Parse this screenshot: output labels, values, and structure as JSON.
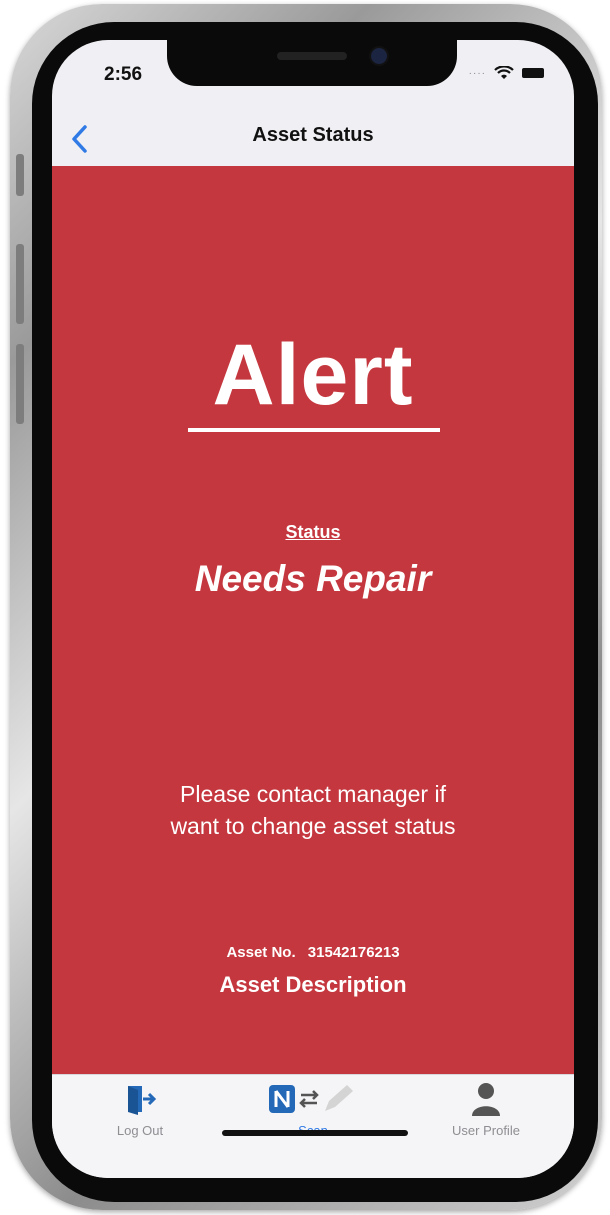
{
  "status_bar": {
    "time": "2:56"
  },
  "nav": {
    "title": "Asset Status"
  },
  "alert": {
    "heading": "Alert",
    "status_label": "Status",
    "status_value": "Needs Repair",
    "message_line1": "Please contact manager if",
    "message_line2": "want to change asset status",
    "asset_no_label": "Asset No.",
    "asset_no_value": "31542176213",
    "asset_description": "Asset Description"
  },
  "tabs": [
    {
      "label": "Log Out",
      "icon": "logout-door-icon"
    },
    {
      "label": "Scan",
      "icon": "nfc-scan-icon",
      "active": true
    },
    {
      "label": "User Profile",
      "icon": "user-profile-icon"
    }
  ],
  "colors": {
    "alert_background": "#c5373e",
    "accent_blue": "#2f7ae5",
    "tab_inactive": "#8e8e93"
  }
}
